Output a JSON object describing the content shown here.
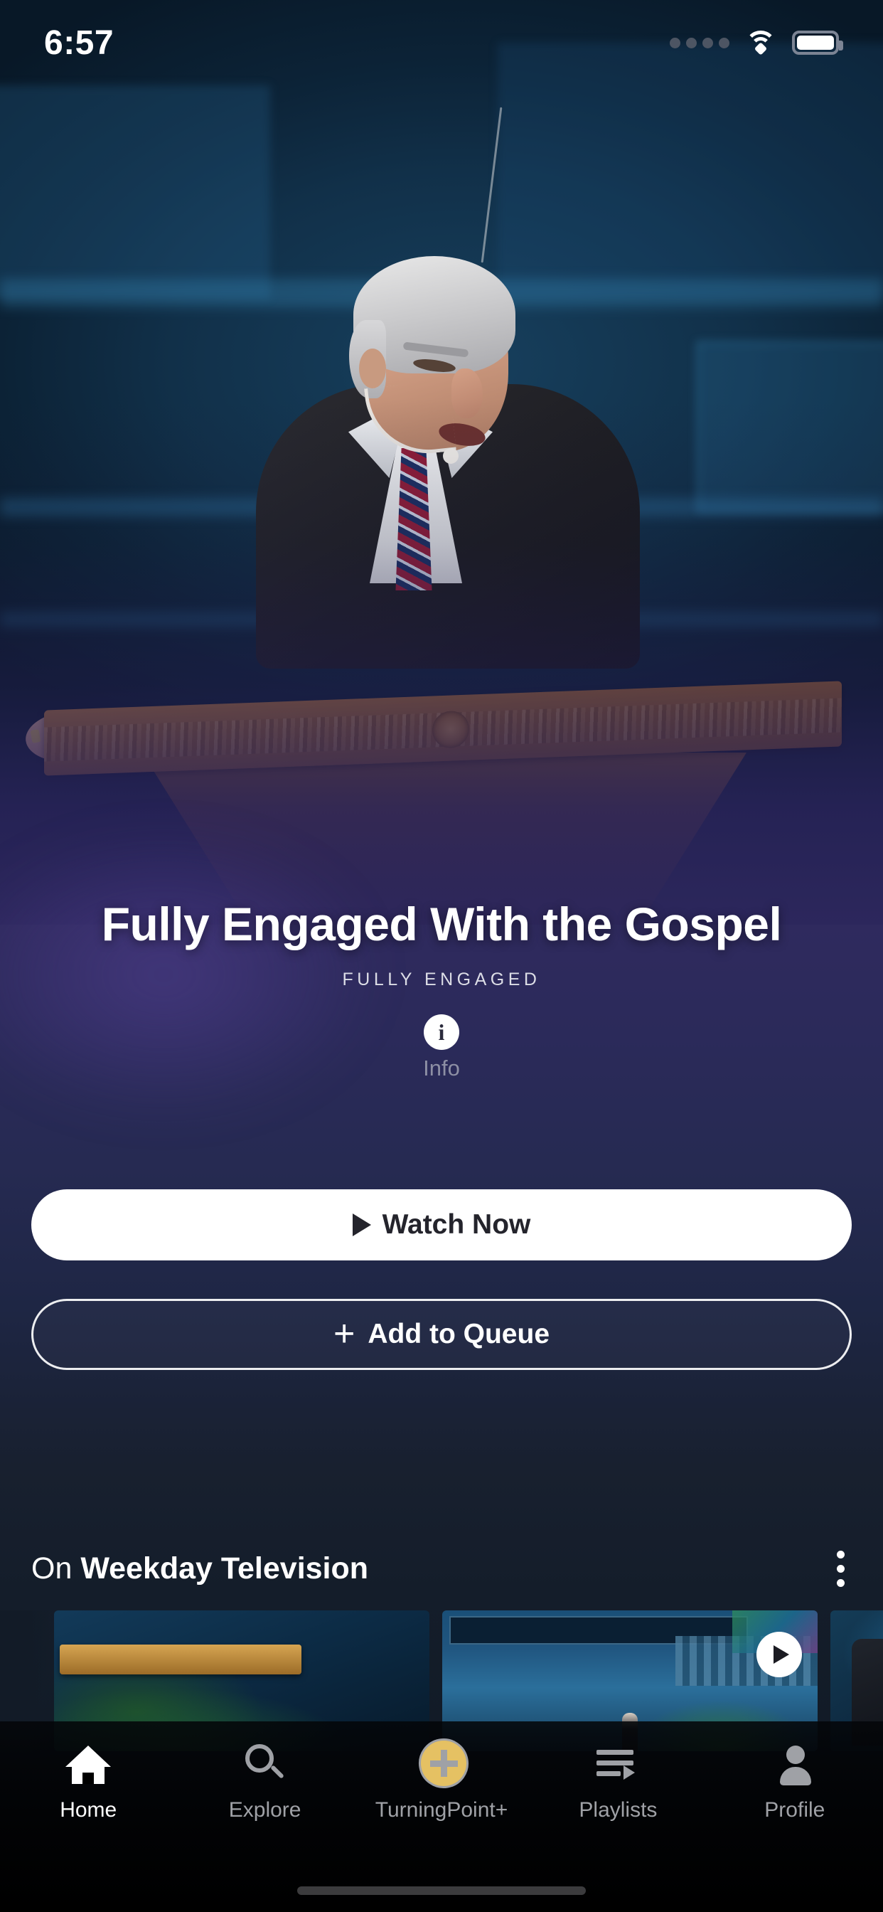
{
  "status_bar": {
    "time": "6:57",
    "cellular_icon": "cellular-dots-icon",
    "wifi_icon": "wifi-icon",
    "battery_icon": "battery-full-icon"
  },
  "hero": {
    "image_alt": "preacher-at-pulpit",
    "title": "Fully Engaged With the Gospel",
    "series": "FULLY ENGAGED",
    "info": {
      "icon": "info-circle-icon",
      "label": "Info"
    }
  },
  "actions": {
    "watch": {
      "label": "Watch Now",
      "icon": "play-icon"
    },
    "queue": {
      "label": "Add to Queue",
      "icon": "plus-icon"
    }
  },
  "row": {
    "prefix": "On",
    "name": "Weekday Television",
    "menu_icon": "more-vertical-icon",
    "cards": [
      {
        "alt": "pulpit-thumbnail",
        "has_play": false
      },
      {
        "alt": "stage-waterfall-thumbnail",
        "has_play": true
      },
      {
        "alt": "partial-thumbnail",
        "has_play": false
      }
    ]
  },
  "tabbar": {
    "items": [
      {
        "label": "Home",
        "icon": "home-icon",
        "active": true
      },
      {
        "label": "Explore",
        "icon": "search-icon",
        "active": false
      },
      {
        "label": "TurningPoint+",
        "icon": "plus-circle-icon",
        "active": false
      },
      {
        "label": "Playlists",
        "icon": "playlist-icon",
        "active": false
      },
      {
        "label": "Profile",
        "icon": "person-icon",
        "active": false
      }
    ]
  },
  "colors": {
    "accent_white": "#ffffff",
    "background_dark": "#121b27",
    "hero_purple": "#2f2a5e",
    "muted_text": "#9fa1a6"
  }
}
